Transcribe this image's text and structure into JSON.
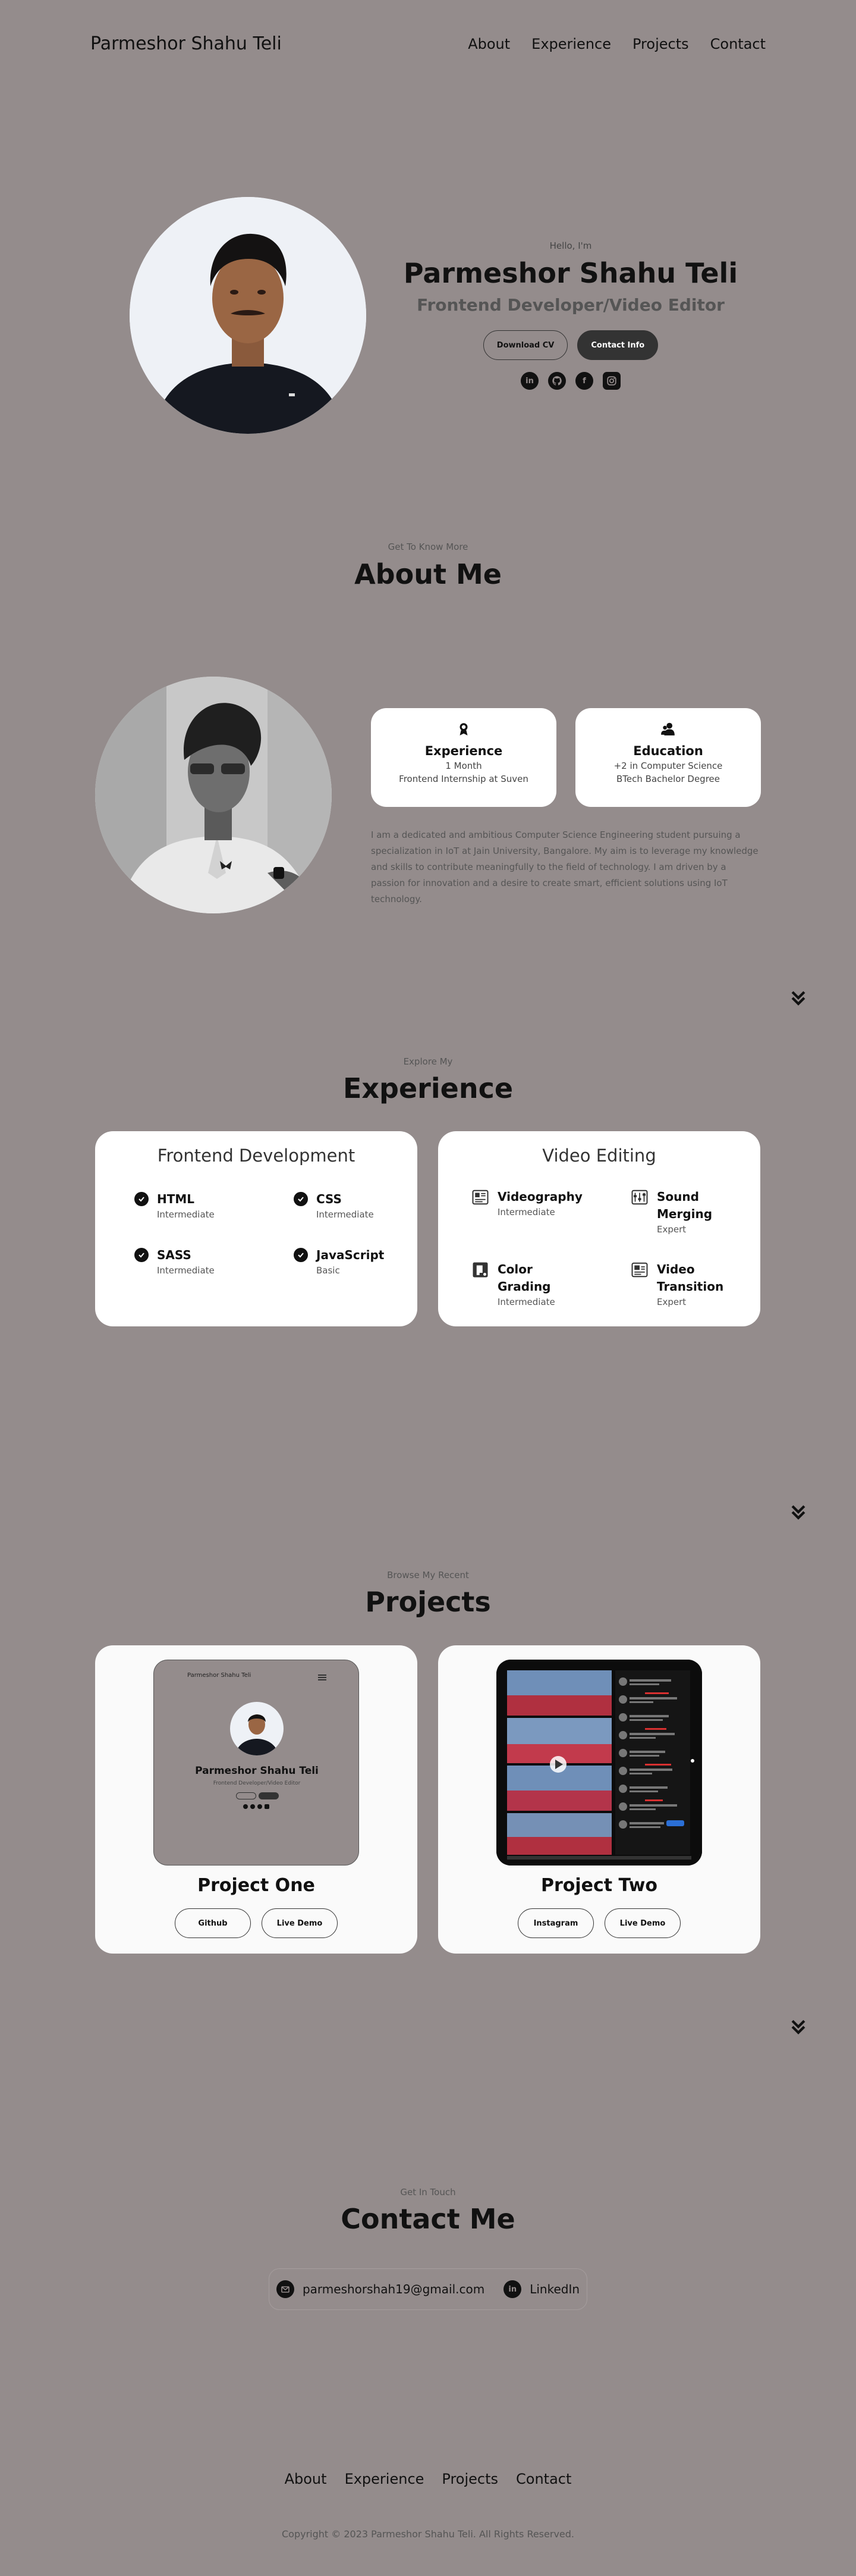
{
  "nav": {
    "logo": "Parmeshor Shahu Teli",
    "links": [
      "About",
      "Experience",
      "Projects",
      "Contact"
    ]
  },
  "hero": {
    "greeting": "Hello, I'm",
    "name": "Parmeshor Shahu Teli",
    "role": "Frontend Developer/Video Editor",
    "download_cv": "Download CV",
    "contact_info": "Contact Info",
    "social_icons": [
      "linkedin-icon",
      "github-icon",
      "facebook-icon",
      "instagram-icon"
    ]
  },
  "about": {
    "subtitle": "Get To Know More",
    "title": "About Me",
    "experience": {
      "title": "Experience",
      "line1": "1 Month",
      "line2": "Frontend Internship at Suven"
    },
    "education": {
      "title": "Education",
      "line1": "+2 in Computer Science",
      "line2": "BTech Bachelor Degree"
    },
    "paragraph": "I am a dedicated and ambitious Computer Science Engineering student pursuing a specialization in IoT at Jain University, Bangalore. My aim is to leverage my knowledge and skills to contribute meaningfully to the field of technology. I am driven by a passion for innovation and a desire to create smart, efficient solutions using IoT technology."
  },
  "experience": {
    "subtitle": "Explore My",
    "title": "Experience",
    "frontend": {
      "title": "Frontend Development",
      "skills": [
        {
          "name": "HTML",
          "level": "Intermediate"
        },
        {
          "name": "CSS",
          "level": "Intermediate"
        },
        {
          "name": "SASS",
          "level": "Intermediate"
        },
        {
          "name": "JavaScript",
          "level": "Basic"
        }
      ]
    },
    "video": {
      "title": "Video Editing",
      "skills": [
        {
          "name_l1": "Videography",
          "name_l2": "",
          "level": "Intermediate"
        },
        {
          "name_l1": "Sound",
          "name_l2": "Merging",
          "level": "Expert"
        },
        {
          "name_l1": "Color",
          "name_l2": "Grading",
          "level": "Intermediate"
        },
        {
          "name_l1": "Video",
          "name_l2": "Transition",
          "level": "Expert"
        }
      ]
    }
  },
  "projects": {
    "subtitle": "Browse My Recent",
    "title": "Projects",
    "items": [
      {
        "title": "Project One",
        "btn1": "Github",
        "btn2": "Live Demo",
        "thumb": {
          "logo": "Parmeshor Shahu Teli",
          "name": "Parmeshor Shahu Teli",
          "role": "Frontend Developer/Video Editor"
        }
      },
      {
        "title": "Project Two",
        "btn1": "Instagram",
        "btn2": "Live Demo"
      }
    ]
  },
  "contact": {
    "subtitle": "Get In Touch",
    "title": "Contact Me",
    "email": "parmeshorshah19@gmail.com",
    "linkedin": "LinkedIn"
  },
  "footer": {
    "links": [
      "About",
      "Experience",
      "Projects",
      "Contact"
    ],
    "copyright": "Copyright © 2023 Parmeshor Shahu Teli. All Rights Reserved."
  }
}
